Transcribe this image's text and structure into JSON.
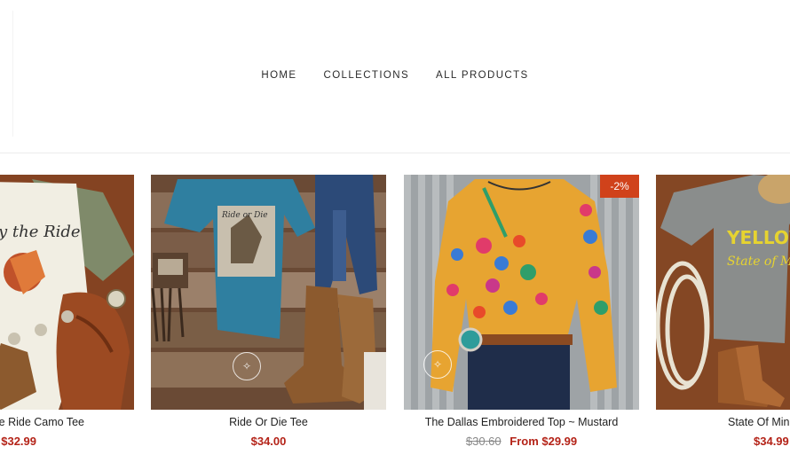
{
  "nav": {
    "items": [
      "HOME",
      "COLLECTIONS",
      "ALL PRODUCTS"
    ]
  },
  "products": [
    {
      "title": "e Ride Camo Tee",
      "price": "$32.99",
      "image_text": "y the Ride"
    },
    {
      "title": "Ride Or Die Tee",
      "price": "$34.00",
      "image_text": "Ride or Die"
    },
    {
      "title": "The Dallas Embroidered Top ~ Mustard",
      "compare_price": "$30.60",
      "price": "From $29.99",
      "badge": "-2%"
    },
    {
      "title": "State Of Min",
      "price": "$34.99",
      "image_text_1": "YELLOWST",
      "image_text_2": "State of M"
    }
  ],
  "colors": {
    "price": "#b42318",
    "badge": "#d0421b",
    "nav_text": "#2b2b2b"
  }
}
